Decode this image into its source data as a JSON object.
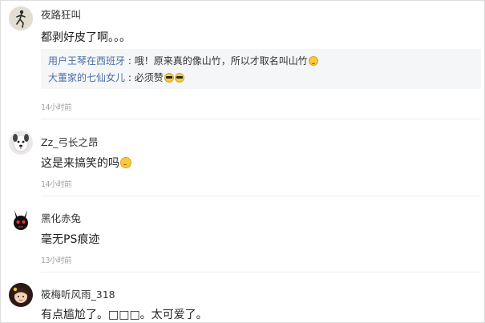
{
  "comments": [
    {
      "username": "夜路狂叫",
      "text": "都剥好皮了啊。。。",
      "time": "14小时前",
      "avatar_icon": "runner-silhouette-avatar",
      "replies": [
        {
          "name": "用户王琴在西班牙",
          "sep": " : ",
          "content": "哦！原来真的像山竹，所以才取名叫山竹",
          "emoji": "smile-emoji"
        },
        {
          "name": "大董家的七仙女儿",
          "sep": " : ",
          "content": "必须赞",
          "emoji": "cool-emoji"
        }
      ]
    },
    {
      "username": "Zz_弓长之昂",
      "text": "这是来搞笑的吗",
      "time": "14小时前",
      "avatar_icon": "dog-avatar",
      "emoji": "laughing-emoji"
    },
    {
      "username": "黑化赤兔",
      "text": "毫无PS痕迹",
      "time": "13小时前",
      "avatar_icon": "black-rabbit-avatar"
    },
    {
      "username": "筱梅听风雨_318",
      "text": "有点尴尬了。□□□。太可爱了。",
      "avatar_icon": "girl-avatar"
    }
  ]
}
